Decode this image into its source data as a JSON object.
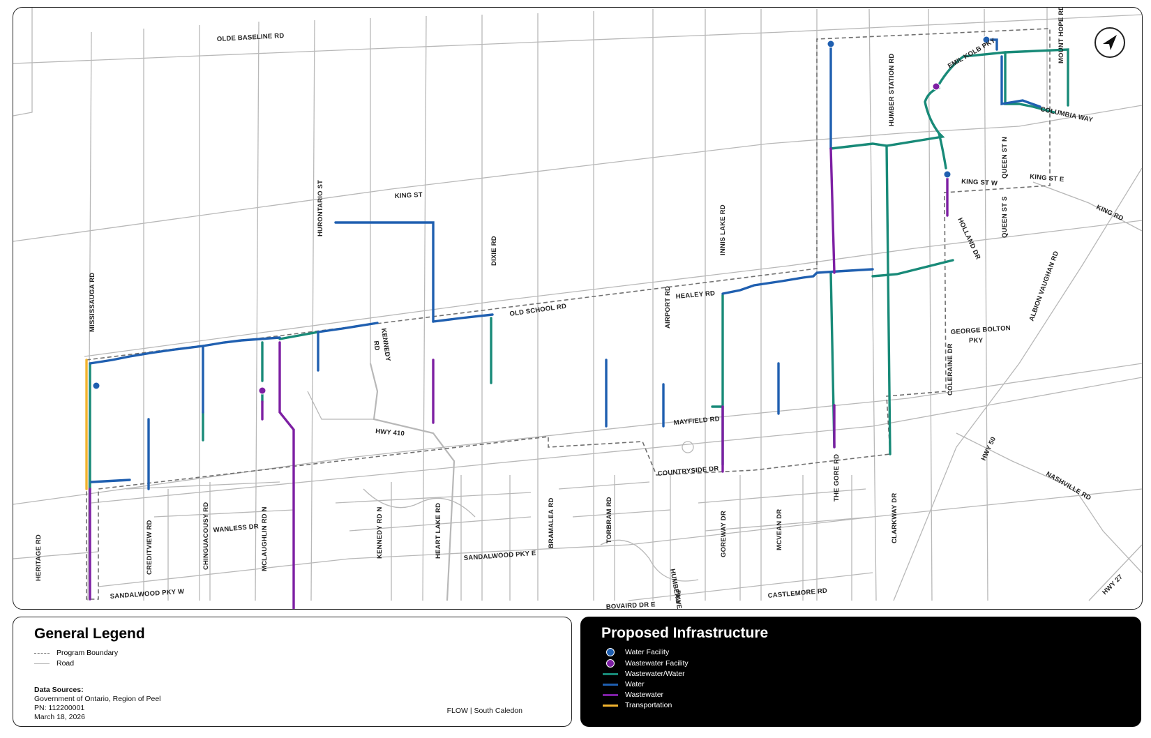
{
  "roads_labels": {
    "olde_baseline": "OLDE BASELINE RD",
    "king_st_mid": "KING ST",
    "mississauga": "MISSISSAUGA RD",
    "hurontario": "HURONTARIO ST",
    "dixie": "DIXIE RD",
    "innis_lake": "INNIS LAKE RD",
    "humber_station": "HUMBER STATION RD",
    "mount_hope": "MOUNT HOPE RD",
    "emil_kolb": "EMIL KOLB PKY",
    "columbia": "COLUMBIA WAY",
    "king_st_w": "KING ST W",
    "queen_st_n": "QUEEN ST N",
    "king_st_e": "KING ST E",
    "king_rd": "KING RD",
    "holland": "HOLLAND DR",
    "queen_st_s": "QUEEN ST S",
    "albion_vaughan": "ALBION VAUGHAN RD",
    "george_bolton": "GEORGE BOLTON",
    "george_bolton_2": "PKY",
    "old_school": "OLD SCHOOL RD",
    "healey": "HEALEY RD",
    "airport": "AIRPORT RD",
    "kennedy_1": "KENNEDY",
    "kennedy_2": "RD",
    "coleraine": "COLERAINE DR",
    "hwy410": "HWY 410",
    "mayfield": "MAYFIELD RD",
    "countryside": "COUNTRYSIDE DR",
    "hwy50": "HWY 50",
    "nashville": "NASHVILLE RD",
    "heritage": "HERITAGE RD",
    "creditview": "CREDITVIEW RD",
    "chinguacousy": "CHINGUACOUSY RD",
    "wanless": "WANLESS DR",
    "mclaughlin": "MCLAUGHLIN RD N",
    "kennedy_n": "KENNEDY RD N",
    "heart_lake": "HEART LAKE RD",
    "bramalea": "BRAMALEA RD",
    "torbram": "TORBRAM RD",
    "sandalwood_e": "SANDALWOOD PKY E",
    "goreway": "GOREWAY DR",
    "mcvean": "MCVEAN DR",
    "the_gore": "THE GORE RD",
    "clarkway": "CLARKWAY DR",
    "sandalwood_w": "SANDALWOOD PKY W",
    "humberwest_1": "HUMBERWEST",
    "humberwest_2": "PKY",
    "castlemore": "CASTLEMORE RD",
    "bovaird": "BOVAIRD DR E",
    "hwy27": "HWY 27"
  },
  "colors": {
    "water": "#1f5fb0",
    "wastewater": "#7d1fa3",
    "wastewater_water": "#188a78",
    "transportation": "#f2b32e",
    "road": "#b8b8b8",
    "boundary": "#6f6f6f"
  },
  "general_legend": {
    "title": "General Legend",
    "items": [
      "Program Boundary",
      "Road"
    ],
    "sources_heading": "Data Sources:",
    "sources_text": "Government of Ontario, Region of Peel",
    "pn": "PN: 112200001",
    "date": "March 18, 2026",
    "project": "FLOW | South Caledon"
  },
  "infra_legend": {
    "title": "Proposed Infrastructure",
    "items": [
      "Water Facility",
      "Wastewater Facility",
      "Wastewater/Water",
      "Water",
      "Wastewater",
      "Transportation"
    ]
  },
  "north_arrow_icon": "north-arrow-icon"
}
